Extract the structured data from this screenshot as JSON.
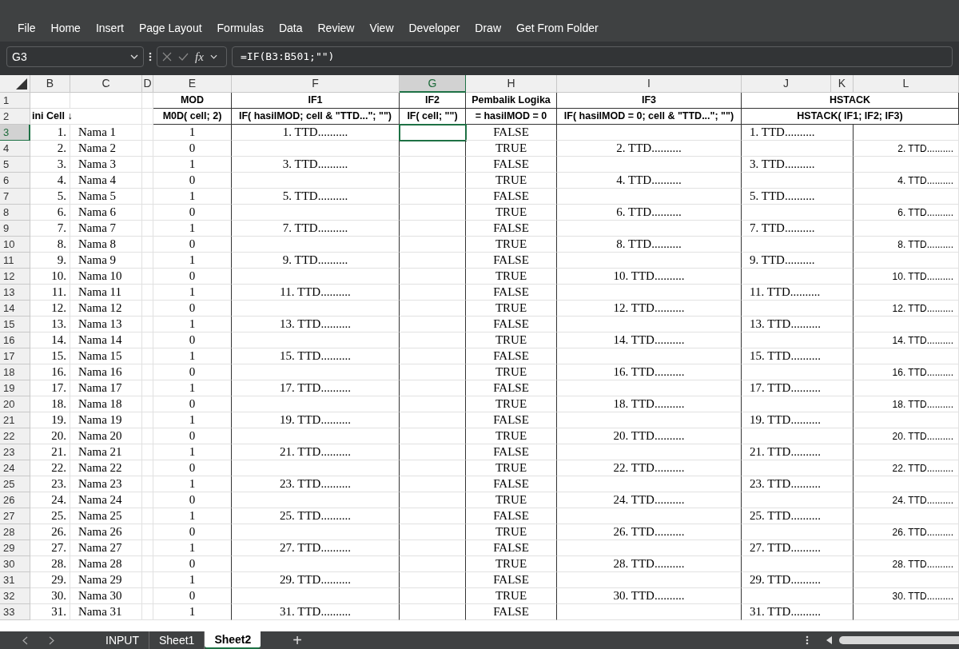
{
  "menu": [
    "File",
    "Home",
    "Insert",
    "Page Layout",
    "Formulas",
    "Data",
    "Review",
    "View",
    "Developer",
    "Draw",
    "Get From Folder"
  ],
  "formula_bar": {
    "name_box": "G3",
    "fx": "fx",
    "formula": "=IF(B3:B501;\"\")"
  },
  "columns": [
    {
      "label": "B",
      "selected": false
    },
    {
      "label": "C",
      "selected": false
    },
    {
      "label": "D",
      "selected": false
    },
    {
      "label": "E",
      "selected": false
    },
    {
      "label": "F",
      "selected": false
    },
    {
      "label": "G",
      "selected": true
    },
    {
      "label": "H",
      "selected": false
    },
    {
      "label": "I",
      "selected": false
    },
    {
      "label": "J",
      "selected": false
    },
    {
      "label": "K",
      "selected": false
    },
    {
      "label": "L",
      "selected": false
    }
  ],
  "header_rows": [
    {
      "num": "1",
      "cells": {
        "E": "MOD",
        "F": "IF1",
        "G": "IF2",
        "H": "Pembalik Logika",
        "I": "IF3",
        "J": "HSTACK"
      }
    },
    {
      "num": "2",
      "cells": {
        "B": "ini Cell ↓",
        "E": "M0D( cell; 2)",
        "F": "IF( hasilMOD; cell & \"TTD...\"; \"\")",
        "G": "IF( cell; \"\")",
        "H": "= hasilMOD = 0",
        "I": "IF( hasilMOD = 0; cell & \"TTD...\"; \"\")",
        "J": "HSTACK( IF1; IF2; IF3)"
      }
    }
  ],
  "rows": [
    {
      "num": "3",
      "selected": true,
      "cells": {
        "B": "1.",
        "C": "Nama 1",
        "E": "1",
        "F": "1. TTD..........",
        "H": "FALSE",
        "J": "1. TTD.........."
      }
    },
    {
      "num": "4",
      "selected": false,
      "cells": {
        "B": "2.",
        "C": "Nama 2",
        "E": "0",
        "H": "TRUE",
        "I": "2. TTD..........",
        "L": "2. TTD.........."
      }
    },
    {
      "num": "5",
      "selected": false,
      "cells": {
        "B": "3.",
        "C": "Nama 3",
        "E": "1",
        "F": "3. TTD..........",
        "H": "FALSE",
        "J": "3. TTD.........."
      }
    },
    {
      "num": "6",
      "selected": false,
      "cells": {
        "B": "4.",
        "C": "Nama 4",
        "E": "0",
        "H": "TRUE",
        "I": "4. TTD..........",
        "L": "4. TTD.........."
      }
    },
    {
      "num": "7",
      "selected": false,
      "cells": {
        "B": "5.",
        "C": "Nama 5",
        "E": "1",
        "F": "5. TTD..........",
        "H": "FALSE",
        "J": "5. TTD.........."
      }
    },
    {
      "num": "8",
      "selected": false,
      "cells": {
        "B": "6.",
        "C": "Nama 6",
        "E": "0",
        "H": "TRUE",
        "I": "6. TTD..........",
        "L": "6. TTD.........."
      }
    },
    {
      "num": "9",
      "selected": false,
      "cells": {
        "B": "7.",
        "C": "Nama 7",
        "E": "1",
        "F": "7. TTD..........",
        "H": "FALSE",
        "J": "7. TTD.........."
      }
    },
    {
      "num": "10",
      "selected": false,
      "cells": {
        "B": "8.",
        "C": "Nama 8",
        "E": "0",
        "H": "TRUE",
        "I": "8. TTD..........",
        "L": "8. TTD.........."
      }
    },
    {
      "num": "11",
      "selected": false,
      "cells": {
        "B": "9.",
        "C": "Nama 9",
        "E": "1",
        "F": "9. TTD..........",
        "H": "FALSE",
        "J": "9. TTD.........."
      }
    },
    {
      "num": "12",
      "selected": false,
      "cells": {
        "B": "10.",
        "C": "Nama 10",
        "E": "0",
        "H": "TRUE",
        "I": "10. TTD..........",
        "L": "10. TTD.........."
      }
    },
    {
      "num": "13",
      "selected": false,
      "cells": {
        "B": "11.",
        "C": "Nama 11",
        "E": "1",
        "F": "11. TTD..........",
        "H": "FALSE",
        "J": "11. TTD.........."
      }
    },
    {
      "num": "14",
      "selected": false,
      "cells": {
        "B": "12.",
        "C": "Nama 12",
        "E": "0",
        "H": "TRUE",
        "I": "12. TTD..........",
        "L": "12. TTD.........."
      }
    },
    {
      "num": "15",
      "selected": false,
      "cells": {
        "B": "13.",
        "C": "Nama 13",
        "E": "1",
        "F": "13. TTD..........",
        "H": "FALSE",
        "J": "13. TTD.........."
      }
    },
    {
      "num": "16",
      "selected": false,
      "cells": {
        "B": "14.",
        "C": "Nama 14",
        "E": "0",
        "H": "TRUE",
        "I": "14. TTD..........",
        "L": "14. TTD.........."
      }
    },
    {
      "num": "17",
      "selected": false,
      "cells": {
        "B": "15.",
        "C": "Nama 15",
        "E": "1",
        "F": "15. TTD..........",
        "H": "FALSE",
        "J": "15. TTD.........."
      }
    },
    {
      "num": "18",
      "selected": false,
      "cells": {
        "B": "16.",
        "C": "Nama 16",
        "E": "0",
        "H": "TRUE",
        "I": "16. TTD..........",
        "L": "16. TTD.........."
      }
    },
    {
      "num": "19",
      "selected": false,
      "cells": {
        "B": "17.",
        "C": "Nama 17",
        "E": "1",
        "F": "17. TTD..........",
        "H": "FALSE",
        "J": "17. TTD.........."
      }
    },
    {
      "num": "20",
      "selected": false,
      "cells": {
        "B": "18.",
        "C": "Nama 18",
        "E": "0",
        "H": "TRUE",
        "I": "18. TTD..........",
        "L": "18. TTD.........."
      }
    },
    {
      "num": "21",
      "selected": false,
      "cells": {
        "B": "19.",
        "C": "Nama 19",
        "E": "1",
        "F": "19. TTD..........",
        "H": "FALSE",
        "J": "19. TTD.........."
      }
    },
    {
      "num": "22",
      "selected": false,
      "cells": {
        "B": "20.",
        "C": "Nama 20",
        "E": "0",
        "H": "TRUE",
        "I": "20. TTD..........",
        "L": "20. TTD.........."
      }
    },
    {
      "num": "23",
      "selected": false,
      "cells": {
        "B": "21.",
        "C": "Nama 21",
        "E": "1",
        "F": "21. TTD..........",
        "H": "FALSE",
        "J": "21. TTD.........."
      }
    },
    {
      "num": "24",
      "selected": false,
      "cells": {
        "B": "22.",
        "C": "Nama 22",
        "E": "0",
        "H": "TRUE",
        "I": "22. TTD..........",
        "L": "22. TTD.........."
      }
    },
    {
      "num": "25",
      "selected": false,
      "cells": {
        "B": "23.",
        "C": "Nama 23",
        "E": "1",
        "F": "23. TTD..........",
        "H": "FALSE",
        "J": "23. TTD.........."
      }
    },
    {
      "num": "26",
      "selected": false,
      "cells": {
        "B": "24.",
        "C": "Nama 24",
        "E": "0",
        "H": "TRUE",
        "I": "24. TTD..........",
        "L": "24. TTD.........."
      }
    },
    {
      "num": "27",
      "selected": false,
      "cells": {
        "B": "25.",
        "C": "Nama 25",
        "E": "1",
        "F": "25. TTD..........",
        "H": "FALSE",
        "J": "25. TTD.........."
      }
    },
    {
      "num": "28",
      "selected": false,
      "cells": {
        "B": "26.",
        "C": "Nama 26",
        "E": "0",
        "H": "TRUE",
        "I": "26. TTD..........",
        "L": "26. TTD.........."
      }
    },
    {
      "num": "29",
      "selected": false,
      "cells": {
        "B": "27.",
        "C": "Nama 27",
        "E": "1",
        "F": "27. TTD..........",
        "H": "FALSE",
        "J": "27. TTD.........."
      }
    },
    {
      "num": "30",
      "selected": false,
      "cells": {
        "B": "28.",
        "C": "Nama 28",
        "E": "0",
        "H": "TRUE",
        "I": "28. TTD..........",
        "L": "28. TTD.........."
      }
    },
    {
      "num": "31",
      "selected": false,
      "cells": {
        "B": "29.",
        "C": "Nama 29",
        "E": "1",
        "F": "29. TTD..........",
        "H": "FALSE",
        "J": "29. TTD.........."
      }
    },
    {
      "num": "32",
      "selected": false,
      "cells": {
        "B": "30.",
        "C": "Nama 30",
        "E": "0",
        "H": "TRUE",
        "I": "30. TTD..........",
        "L": "30. TTD.........."
      }
    },
    {
      "num": "33",
      "selected": false,
      "cells": {
        "B": "31.",
        "C": "Nama 31",
        "E": "1",
        "F": "31. TTD..........",
        "H": "FALSE",
        "J": "31. TTD.........."
      }
    }
  ],
  "sheet_tabs": [
    {
      "label": "INPUT",
      "selected": false
    },
    {
      "label": "Sheet1",
      "selected": false
    },
    {
      "label": "Sheet2",
      "selected": true
    }
  ],
  "add_sheet": "+"
}
